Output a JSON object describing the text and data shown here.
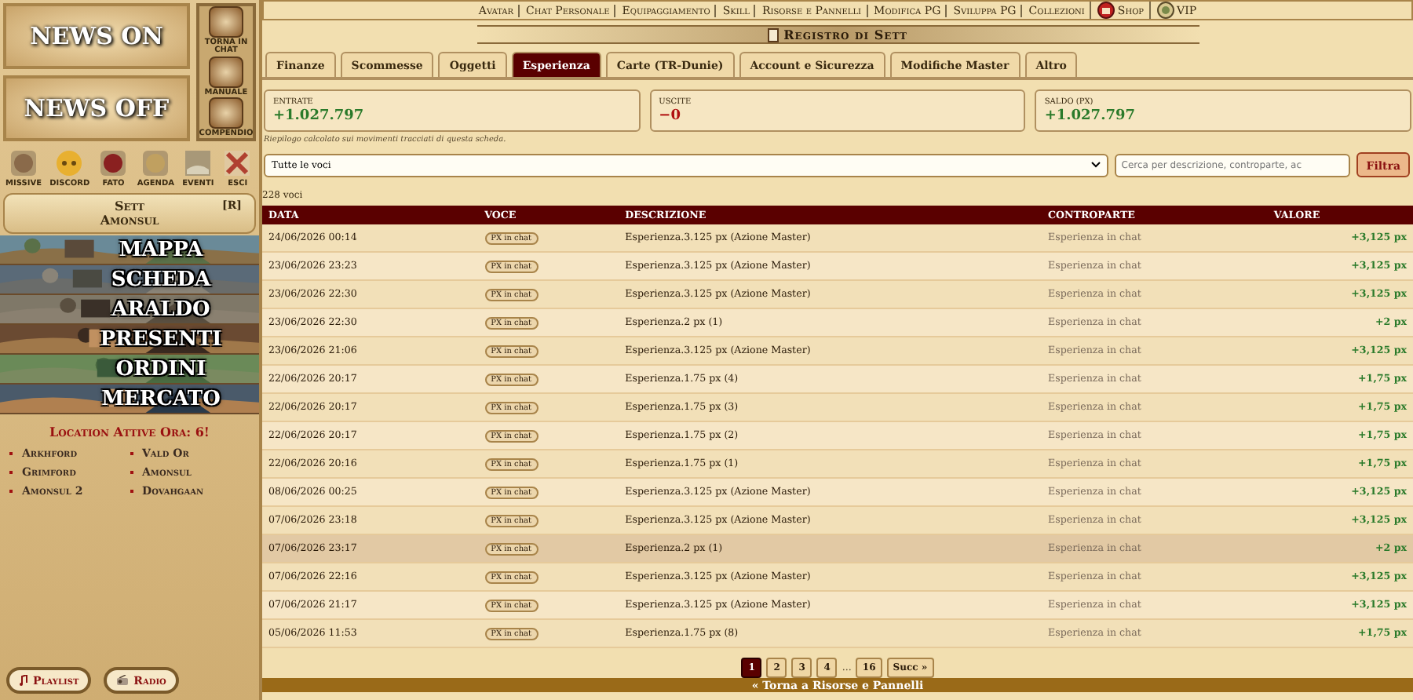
{
  "sidebar": {
    "news_buttons": [
      "NEWS ON",
      "NEWS OFF"
    ],
    "side_buttons": [
      {
        "label": "TORNA IN CHAT"
      },
      {
        "label": "MANUALE"
      },
      {
        "label": "COMPENDIO"
      }
    ],
    "icon_buttons": [
      {
        "label": "MISSIVE"
      },
      {
        "label": "DISCORD"
      },
      {
        "label": "FATO"
      },
      {
        "label": "AGENDA"
      },
      {
        "label": "EVENTI"
      },
      {
        "label": "ESCI"
      }
    ],
    "character": {
      "name": "Sett",
      "location": "Amonsul",
      "tag": "[R]"
    },
    "nav": [
      "MAPPA",
      "SCHEDA",
      "ARALDO",
      "PRESENTI",
      "ORDINI",
      "MERCATO"
    ],
    "locations_title": "Location Attive Ora: 6!",
    "locations": [
      "Arkhford",
      "Vald Or",
      "Grimford",
      "Amonsul",
      "Amonsul 2",
      "Dovahgaan"
    ],
    "bottom_buttons": [
      "Playlist",
      "Radio"
    ]
  },
  "top_menu": [
    {
      "label": "Avatar"
    },
    {
      "label": "Chat Personale"
    },
    {
      "label": "Equipaggiamento"
    },
    {
      "label": "Skill"
    },
    {
      "label": "Risorse e Pannelli"
    },
    {
      "label": "Modifica PG"
    },
    {
      "label": "Sviluppa PG"
    },
    {
      "label": "Collezioni"
    },
    {
      "label": "Shop",
      "kind": "shop"
    },
    {
      "label": "VIP",
      "kind": "vip"
    }
  ],
  "page_title": "Registro di Sett",
  "tabs": [
    {
      "label": "Finanze",
      "selected": false
    },
    {
      "label": "Scommesse",
      "selected": false
    },
    {
      "label": "Oggetti",
      "selected": false
    },
    {
      "label": "Esperienza",
      "selected": true
    },
    {
      "label": "Carte (TR-Dunie)",
      "selected": false
    },
    {
      "label": "Account e Sicurezza",
      "selected": false
    },
    {
      "label": "Modifiche Master",
      "selected": false
    },
    {
      "label": "Altro",
      "selected": false
    }
  ],
  "summary": [
    {
      "label": "ENTRATE",
      "value": "+1.027.797",
      "kind": "positive"
    },
    {
      "label": "USCITE",
      "value": "−0",
      "kind": "negative"
    },
    {
      "label": "SALDO (PX)",
      "value": "+1.027.797",
      "kind": "positive"
    }
  ],
  "summary_note": "Riepilogo calcolato sui movimenti tracciati di questa scheda.",
  "filter": {
    "select_value": "Tutte le voci",
    "search_placeholder": "Cerca per descrizione, controparte, ac",
    "button": "Filtra"
  },
  "count": "228 voci",
  "table": {
    "columns": [
      "DATA",
      "VOCE",
      "DESCRIZIONE",
      "CONTROPARTE",
      "VALORE"
    ],
    "rows": [
      {
        "date": "24/06/2026 00:14",
        "tag": "PX in chat",
        "description": "Esperienza.3.125 px (Azione Master)",
        "counterpart": "Esperienza in chat",
        "value": "+3,125 px",
        "highlighted": false
      },
      {
        "date": "23/06/2026 23:23",
        "tag": "PX in chat",
        "description": "Esperienza.3.125 px (Azione Master)",
        "counterpart": "Esperienza in chat",
        "value": "+3,125 px",
        "highlighted": false
      },
      {
        "date": "23/06/2026 22:30",
        "tag": "PX in chat",
        "description": "Esperienza.3.125 px (Azione Master)",
        "counterpart": "Esperienza in chat",
        "value": "+3,125 px",
        "highlighted": false
      },
      {
        "date": "23/06/2026 22:30",
        "tag": "PX in chat",
        "description": "Esperienza.2 px (1)",
        "counterpart": "Esperienza in chat",
        "value": "+2 px",
        "highlighted": false
      },
      {
        "date": "23/06/2026 21:06",
        "tag": "PX in chat",
        "description": "Esperienza.3.125 px (Azione Master)",
        "counterpart": "Esperienza in chat",
        "value": "+3,125 px",
        "highlighted": false
      },
      {
        "date": "22/06/2026 20:17",
        "tag": "PX in chat",
        "description": "Esperienza.1.75 px (4)",
        "counterpart": "Esperienza in chat",
        "value": "+1,75 px",
        "highlighted": false
      },
      {
        "date": "22/06/2026 20:17",
        "tag": "PX in chat",
        "description": "Esperienza.1.75 px (3)",
        "counterpart": "Esperienza in chat",
        "value": "+1,75 px",
        "highlighted": false
      },
      {
        "date": "22/06/2026 20:17",
        "tag": "PX in chat",
        "description": "Esperienza.1.75 px (2)",
        "counterpart": "Esperienza in chat",
        "value": "+1,75 px",
        "highlighted": false
      },
      {
        "date": "22/06/2026 20:16",
        "tag": "PX in chat",
        "description": "Esperienza.1.75 px (1)",
        "counterpart": "Esperienza in chat",
        "value": "+1,75 px",
        "highlighted": false
      },
      {
        "date": "08/06/2026 00:25",
        "tag": "PX in chat",
        "description": "Esperienza.3.125 px (Azione Master)",
        "counterpart": "Esperienza in chat",
        "value": "+3,125 px",
        "highlighted": false
      },
      {
        "date": "07/06/2026 23:18",
        "tag": "PX in chat",
        "description": "Esperienza.3.125 px (Azione Master)",
        "counterpart": "Esperienza in chat",
        "value": "+3,125 px",
        "highlighted": false
      },
      {
        "date": "07/06/2026 23:17",
        "tag": "PX in chat",
        "description": "Esperienza.2 px (1)",
        "counterpart": "Esperienza in chat",
        "value": "+2 px",
        "highlighted": true
      },
      {
        "date": "07/06/2026 22:16",
        "tag": "PX in chat",
        "description": "Esperienza.3.125 px (Azione Master)",
        "counterpart": "Esperienza in chat",
        "value": "+3,125 px",
        "highlighted": false
      },
      {
        "date": "07/06/2026 21:17",
        "tag": "PX in chat",
        "description": "Esperienza.3.125 px (Azione Master)",
        "counterpart": "Esperienza in chat",
        "value": "+3,125 px",
        "highlighted": false
      },
      {
        "date": "05/06/2026 11:53",
        "tag": "PX in chat",
        "description": "Esperienza.1.75 px (8)",
        "counterpart": "Esperienza in chat",
        "value": "+1,75 px",
        "highlighted": false
      }
    ]
  },
  "pagination": [
    {
      "label": "1",
      "kind": "page",
      "selected": true
    },
    {
      "label": "2",
      "kind": "page",
      "selected": false
    },
    {
      "label": "3",
      "kind": "page",
      "selected": false
    },
    {
      "label": "4",
      "kind": "page",
      "selected": false
    },
    {
      "label": "…",
      "kind": "gap"
    },
    {
      "label": "16",
      "kind": "page",
      "selected": false
    },
    {
      "label": "Succ »",
      "kind": "next",
      "selected": false
    }
  ],
  "back_link": "« Torna a Risorse e Pannelli"
}
